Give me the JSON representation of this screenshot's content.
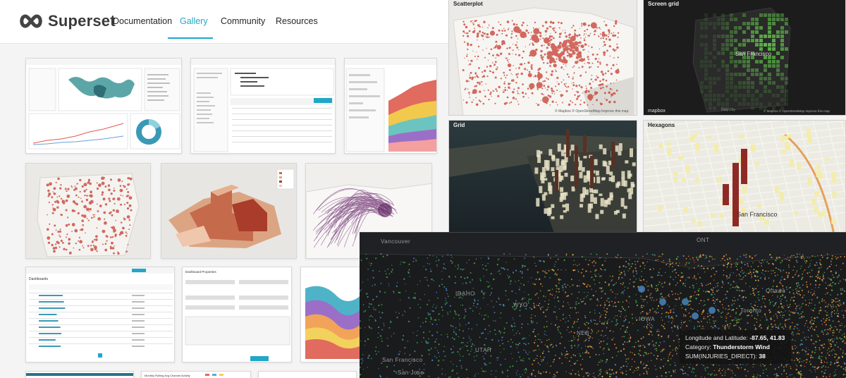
{
  "nav": {
    "brand": "Superset",
    "links": [
      "Documentation",
      "Gallery",
      "Community",
      "Resources"
    ],
    "active": "Gallery",
    "accent": "#20a7c9"
  },
  "panels": {
    "scatterplot": {
      "title": "Scatterplot",
      "attribution": "© Mapbox © OpenStreetMap Improve this map"
    },
    "screen_grid": {
      "title": "Screen grid",
      "city": "San Francisco",
      "sub_city": "Daly City",
      "logo": "mapbox",
      "attribution": "© Mapbox © OpenStreetMap Improve this map"
    },
    "grid": {
      "title": "Grid"
    },
    "hexagons": {
      "title": "Hexagons",
      "city": "San Francisco"
    }
  },
  "usmap": {
    "labels": [
      "Vancouver",
      "ONT",
      "Ottawa",
      "Toronto",
      "IDAHO",
      "WYO",
      "IOWA",
      "NEB",
      "UTAH",
      "San Francisco",
      "San Jose"
    ],
    "tooltip": {
      "line1_label": "Longitude and Latitude:",
      "line1_value": "-87.65, 41.83",
      "line2_label": "Category:",
      "line2_value": "Thunderstorm Wind",
      "line3_label": "SUM(INJURIES_DIRECT):",
      "line3_value": "38"
    }
  },
  "thumbs": {
    "chart4_title": "Monthly Rolling Avg Channel Activity",
    "dashboards_title": "Dashboards",
    "dashboard_props": "Dashboard Properties"
  },
  "colors": {
    "map_red": "#c73b2e",
    "grid_green": "#5fb84a",
    "us_orange": "#e88a3b",
    "us_blue": "#4a8bc7",
    "us_green": "#3fa34a"
  }
}
